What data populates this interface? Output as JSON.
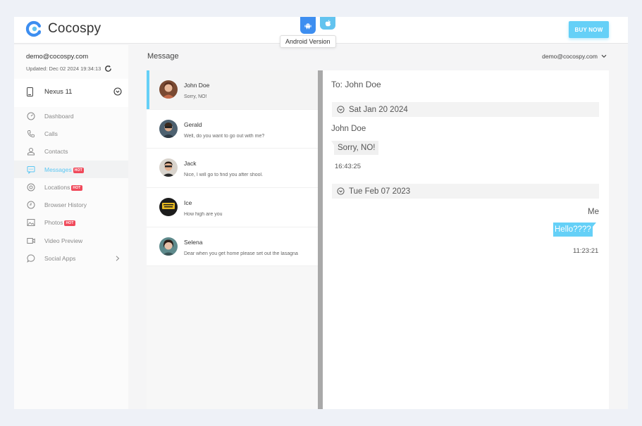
{
  "header": {
    "logo_text": "Cocospy",
    "platforms": [
      {
        "name": "Android",
        "icon": "android-icon",
        "color": "#3d8ef0"
      },
      {
        "name": "iOS",
        "icon": "apple-icon",
        "color": "#62c3ef"
      }
    ],
    "tooltip": "Android Version",
    "buy_button": "BUY NOW"
  },
  "sidebar": {
    "account_email": "demo@cocospy.com",
    "updated": "Updated: Dec 02 2024 19:34:13",
    "device": "Nexus 11",
    "items": [
      {
        "label": "Dashboard",
        "icon": "dashboard-icon",
        "hot": false,
        "active": false
      },
      {
        "label": "Calls",
        "icon": "phone-icon",
        "hot": false,
        "active": false
      },
      {
        "label": "Contacts",
        "icon": "contacts-icon",
        "hot": false,
        "active": false
      },
      {
        "label": "Messages",
        "icon": "message-icon",
        "hot": true,
        "active": true
      },
      {
        "label": "Locations",
        "icon": "location-icon",
        "hot": true,
        "active": false
      },
      {
        "label": "Browser History",
        "icon": "clock-icon",
        "hot": false,
        "active": false
      },
      {
        "label": "Photos",
        "icon": "image-icon",
        "hot": true,
        "active": false
      },
      {
        "label": "Video Preview",
        "icon": "video-icon",
        "hot": false,
        "active": false
      },
      {
        "label": "Social Apps",
        "icon": "chat-bubble-icon",
        "hot": false,
        "active": false
      }
    ],
    "hot_label": "HOT"
  },
  "main": {
    "title": "Message",
    "account_select": "demo@cocospy.com"
  },
  "contacts": [
    {
      "name": "John Doe",
      "preview": "Sorry, NO!",
      "active": true
    },
    {
      "name": "Gerald",
      "preview": "Well, do you want to go out with me?",
      "active": false
    },
    {
      "name": "Jack",
      "preview": "Nice, I will go to find you after shool.",
      "active": false
    },
    {
      "name": "Ice",
      "preview": "How high are you",
      "active": false
    },
    {
      "name": "Selena",
      "preview": "Dear when you get home please set out the lasagna",
      "active": false
    }
  ],
  "chat": {
    "to": "To: John Doe",
    "groups": [
      {
        "date": "Sat Jan 20 2024",
        "sender": "John Doe",
        "message": "Sorry, NO!",
        "time": "16:43:25"
      },
      {
        "date": "Tue Feb 07 2023",
        "sender": "Me",
        "message": "Hello????",
        "time": "11:23:21"
      }
    ]
  },
  "colors": {
    "accent": "#65d0f7",
    "android_blue": "#3d8ef0",
    "hot_badge": "#f0495a"
  }
}
